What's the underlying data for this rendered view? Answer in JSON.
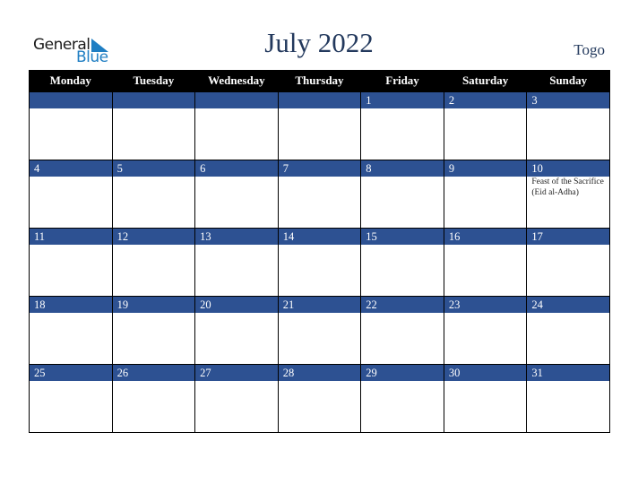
{
  "logo": {
    "word1": "General",
    "word2": "Blue"
  },
  "title": "July 2022",
  "country": "Togo",
  "colors": {
    "header_bg": "#000000",
    "date_bar": "#2d5192",
    "title": "#23395d",
    "logo_blue": "#1f7ec3"
  },
  "weekdays": [
    "Monday",
    "Tuesday",
    "Wednesday",
    "Thursday",
    "Friday",
    "Saturday",
    "Sunday"
  ],
  "weeks": [
    [
      {
        "day": ""
      },
      {
        "day": ""
      },
      {
        "day": ""
      },
      {
        "day": ""
      },
      {
        "day": "1"
      },
      {
        "day": "2"
      },
      {
        "day": "3"
      }
    ],
    [
      {
        "day": "4"
      },
      {
        "day": "5"
      },
      {
        "day": "6"
      },
      {
        "day": "7"
      },
      {
        "day": "8"
      },
      {
        "day": "9"
      },
      {
        "day": "10",
        "holiday": "Feast of the Sacrifice (Eid al-Adha)"
      }
    ],
    [
      {
        "day": "11"
      },
      {
        "day": "12"
      },
      {
        "day": "13"
      },
      {
        "day": "14"
      },
      {
        "day": "15"
      },
      {
        "day": "16"
      },
      {
        "day": "17"
      }
    ],
    [
      {
        "day": "18"
      },
      {
        "day": "19"
      },
      {
        "day": "20"
      },
      {
        "day": "21"
      },
      {
        "day": "22"
      },
      {
        "day": "23"
      },
      {
        "day": "24"
      }
    ],
    [
      {
        "day": "25"
      },
      {
        "day": "26"
      },
      {
        "day": "27"
      },
      {
        "day": "28"
      },
      {
        "day": "29"
      },
      {
        "day": "30"
      },
      {
        "day": "31"
      }
    ]
  ]
}
